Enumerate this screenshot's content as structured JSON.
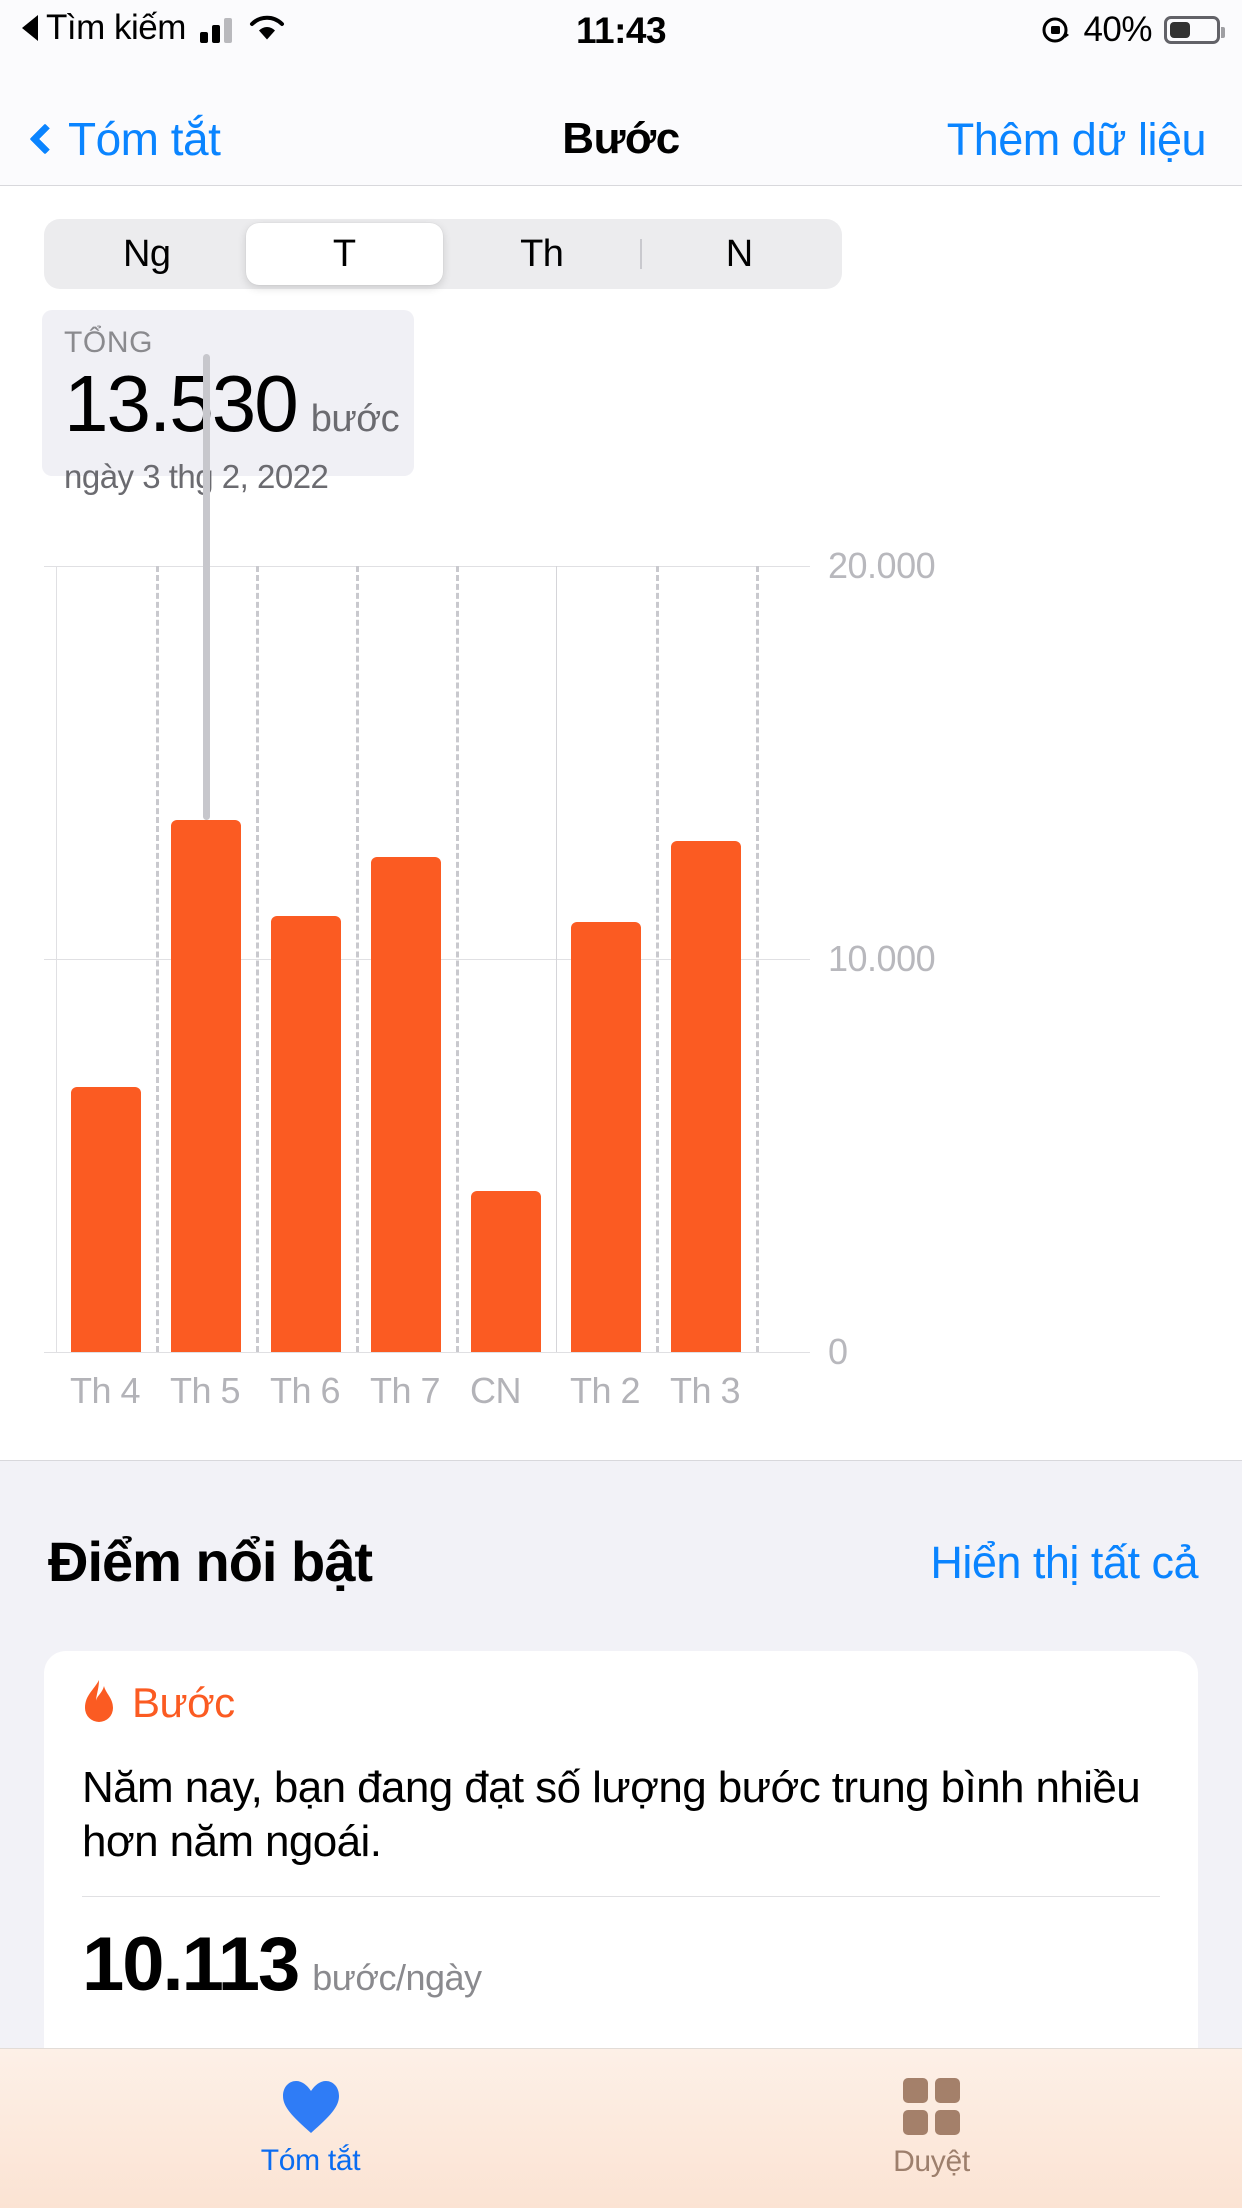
{
  "status_bar": {
    "back_indicator": "back-triangle-icon",
    "carrier_label": "Tìm kiếm",
    "signal_icon": "cellular-signal-icon",
    "wifi_icon": "wifi-icon",
    "time": "11:43",
    "orientation_lock_icon": "rotation-lock-icon",
    "battery_percent": "40%",
    "battery_icon": "battery-icon",
    "battery_level": 40
  },
  "nav_bar": {
    "back_icon": "chevron-left-icon",
    "back_label": "Tóm tắt",
    "title": "Bước",
    "action_label": "Thêm dữ liệu"
  },
  "segmented_control": {
    "options": [
      {
        "label": "Ng",
        "selected": false
      },
      {
        "label": "T",
        "selected": true
      },
      {
        "label": "Th",
        "selected": false
      },
      {
        "label": "N",
        "selected": false
      }
    ]
  },
  "summary": {
    "label": "TỔNG",
    "value": "13.530",
    "unit": "bước",
    "date": "ngày 3 thg 2, 2022"
  },
  "chart_data": {
    "type": "bar",
    "title": "Bước",
    "categories": [
      "Th 4",
      "Th 5",
      "Th 6",
      "Th 7",
      "CN",
      "Th 2",
      "Th 3"
    ],
    "values": [
      6750,
      13530,
      11100,
      12600,
      4100,
      10950,
      13000
    ],
    "selected_index": 1,
    "selected_value": 13530,
    "selected_label": "ngày 3 thg 2, 2022",
    "ylabel": "",
    "xlabel": "",
    "ylim": [
      0,
      20000
    ],
    "ytick_labels": [
      "20.000",
      "10.000",
      "0"
    ],
    "ytick_values": [
      20000,
      10000,
      0
    ],
    "grid": true,
    "legend": "none",
    "bar_color": "#fb5b22",
    "selection_line_color": "#c7c7cc"
  },
  "highlights": {
    "title": "Điểm nổi bật",
    "show_all_label": "Hiển thị tất cả",
    "card": {
      "icon": "flame-icon",
      "kind": "Bước",
      "body": "Năm nay, bạn đang đạt số lượng bước trung bình nhiều hơn năm ngoái.",
      "value": "10.113",
      "value_unit": "bước/ngày"
    }
  },
  "tab_bar": {
    "tabs": [
      {
        "label": "Tóm tắt",
        "icon": "heart-icon",
        "active": true
      },
      {
        "label": "Duyệt",
        "icon": "grid-icon",
        "active": false
      }
    ]
  },
  "colors": {
    "accent_blue": "#0a84ff",
    "steps_orange": "#fb5b22",
    "group_bg": "#f2f2f7"
  }
}
